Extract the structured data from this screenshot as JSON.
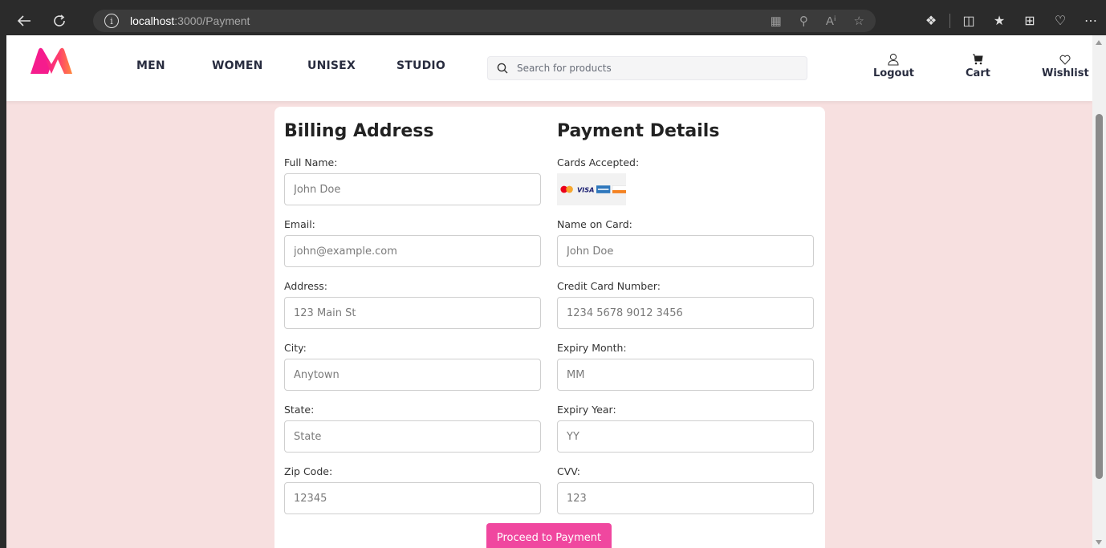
{
  "browser": {
    "url_host": "localhost",
    "url_path": ":3000/Payment"
  },
  "header": {
    "nav": [
      "MEN",
      "WOMEN",
      "UNISEX",
      "STUDIO"
    ],
    "search_placeholder": "Search for products",
    "actions": {
      "logout": "Logout",
      "cart": "Cart",
      "wishlist": "Wishlist"
    }
  },
  "billing": {
    "title": "Billing Address",
    "fields": [
      {
        "label": "Full Name:",
        "placeholder": "John Doe"
      },
      {
        "label": "Email:",
        "placeholder": "john@example.com"
      },
      {
        "label": "Address:",
        "placeholder": "123 Main St"
      },
      {
        "label": "City:",
        "placeholder": "Anytown"
      },
      {
        "label": "State:",
        "placeholder": "State"
      },
      {
        "label": "Zip Code:",
        "placeholder": "12345"
      }
    ]
  },
  "payment": {
    "title": "Payment Details",
    "cards_label": "Cards Accepted:",
    "cards": [
      "mastercard",
      "VISA",
      "amex",
      "discover"
    ],
    "fields": [
      {
        "label": "Name on Card:",
        "placeholder": "John Doe"
      },
      {
        "label": "Credit Card Number:",
        "placeholder": "1234 5678 9012 3456"
      },
      {
        "label": "Expiry Month:",
        "placeholder": "MM"
      },
      {
        "label": "Expiry Year:",
        "placeholder": "YY"
      },
      {
        "label": "CVV:",
        "placeholder": "123"
      }
    ]
  },
  "submit_label": "Proceed to Payment",
  "colors": {
    "accent": "#f0479f",
    "page_bg": "#f7e0e0"
  }
}
